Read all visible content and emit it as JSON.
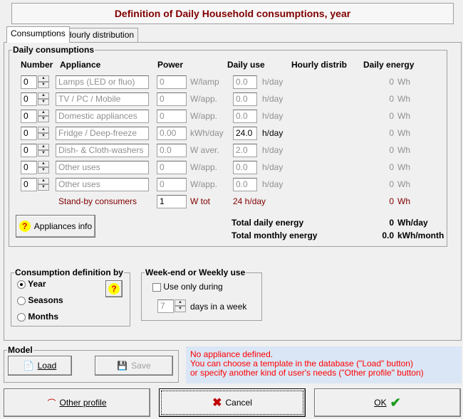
{
  "title": "Definition of Daily Household consumptions, year",
  "tabs": [
    "Consumptions",
    "Hourly distribution"
  ],
  "daily": {
    "legend": "Daily consumptions",
    "headers": {
      "number": "Number",
      "appliance": "Appliance",
      "power": "Power",
      "daily_use": "Daily use",
      "hourly": "Hourly distrib",
      "energy": "Daily energy"
    },
    "rows": [
      {
        "number": "0",
        "appliance": "Lamps (LED or fluo)",
        "power": "0",
        "power_unit": "W/lamp",
        "use": "0.0",
        "use_unit": "h/day",
        "energy": "0",
        "energy_unit": "Wh",
        "enabled": false
      },
      {
        "number": "0",
        "appliance": "TV / PC / Mobile",
        "power": "0",
        "power_unit": "W/app.",
        "use": "0.0",
        "use_unit": "h/day",
        "energy": "0",
        "energy_unit": "Wh",
        "enabled": false
      },
      {
        "number": "0",
        "appliance": "Domestic appliances",
        "power": "0",
        "power_unit": "W/app.",
        "use": "0.0",
        "use_unit": "h/day",
        "energy": "0",
        "energy_unit": "Wh",
        "enabled": false
      },
      {
        "number": "0",
        "appliance": "Fridge / Deep-freeze",
        "power": "0.00",
        "power_unit": "kWh/day",
        "use": "24.0",
        "use_unit": "h/day",
        "energy": "0",
        "energy_unit": "Wh",
        "enabled": true
      },
      {
        "number": "0",
        "appliance": "Dish- & Cloth-washers",
        "power": "0.0",
        "power_unit": "W aver.",
        "use": "2.0",
        "use_unit": "h/day",
        "energy": "0",
        "energy_unit": "Wh",
        "enabled": false
      },
      {
        "number": "0",
        "appliance": "Other uses",
        "power": "0",
        "power_unit": "W/app.",
        "use": "0.0",
        "use_unit": "h/day",
        "energy": "0",
        "energy_unit": "Wh",
        "enabled": false
      },
      {
        "number": "0",
        "appliance": "Other uses",
        "power": "0",
        "power_unit": "W/app.",
        "use": "0.0",
        "use_unit": "h/day",
        "energy": "0",
        "energy_unit": "Wh",
        "enabled": false
      }
    ],
    "standby": {
      "label": "Stand-by consumers",
      "power": "1",
      "unit": "W tot",
      "use": "24 h/day",
      "energy": "0",
      "energy_unit": "Wh"
    },
    "appliances_info": "Appliances info",
    "total_daily_label": "Total daily energy",
    "total_daily_value": "0",
    "total_daily_unit": "Wh/day",
    "total_monthly_label": "Total monthly energy",
    "total_monthly_value": "0.0",
    "total_monthly_unit": "kWh/month"
  },
  "definition": {
    "legend": "Consumption definition by",
    "options": [
      "Year",
      "Seasons",
      "Months"
    ],
    "selected": "Year"
  },
  "weekly": {
    "legend": "Week-end or Weekly use",
    "checkbox": "Use only during",
    "checked": false,
    "days": "7",
    "days_label": "days in a week"
  },
  "model": {
    "legend": "Model",
    "load": "Load",
    "save": "Save"
  },
  "message": [
    "No appliance defined.",
    "You can choose a template in the database (\"Load\" button)",
    "or specify another kind of user's needs (\"Other profile\" button)"
  ],
  "buttons": {
    "other_profile": "Other profile",
    "cancel": "Cancel",
    "ok": "OK"
  },
  "colors": {
    "title": "#800000",
    "message": "#ff0000",
    "message_bg": "#dae6f5",
    "ok_check": "#1a9a1a",
    "cancel_x": "#c00000"
  }
}
